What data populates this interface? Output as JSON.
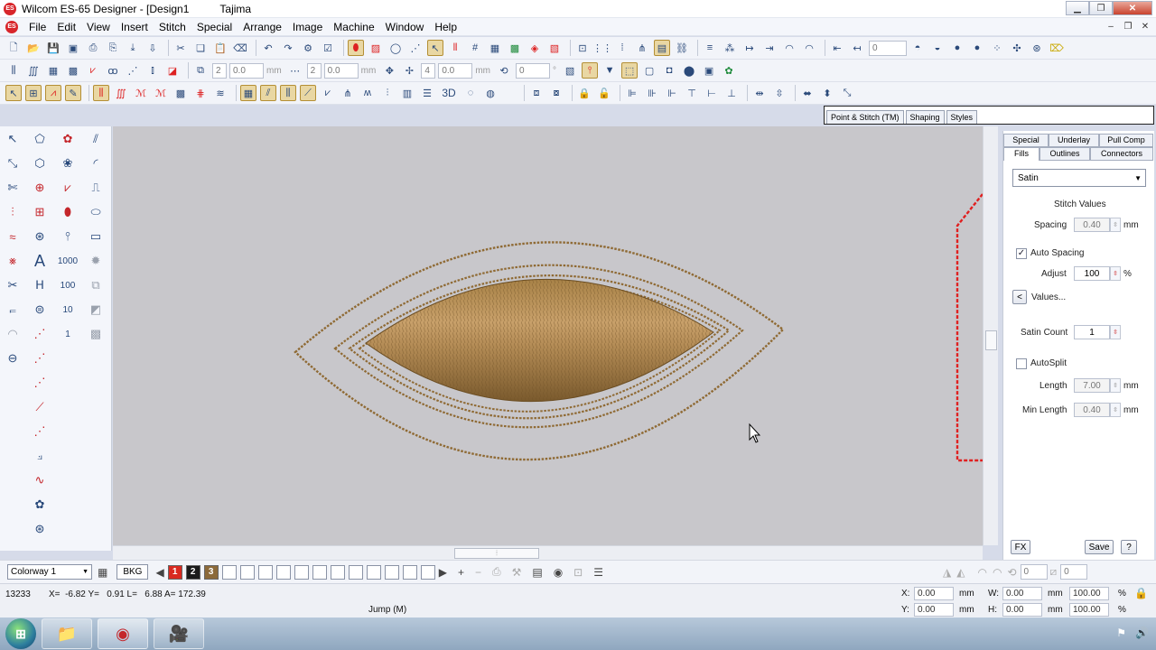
{
  "window": {
    "title": "Wilcom ES-65 Designer - [Design1",
    "machine": "Tajima",
    "app_icon_text": "ES"
  },
  "menu": {
    "items": [
      "File",
      "Edit",
      "View",
      "Insert",
      "Stitch",
      "Special",
      "Arrange",
      "Image",
      "Machine",
      "Window",
      "Help"
    ]
  },
  "toolbar1": {
    "field_zero": "0"
  },
  "toolbar2": {
    "count_a": "2",
    "value_a": "0.0",
    "unit_a": "mm",
    "count_b": "2",
    "value_b": "0.0",
    "unit_b": "mm",
    "count_c": "4",
    "value_c": "0.0",
    "unit_c": "mm",
    "value_d": "0",
    "unit_d": "°"
  },
  "toolbar3": {
    "label_3d": "3D"
  },
  "top_tabs": [
    "Point & Stitch (TM)",
    "Shaping",
    "Styles"
  ],
  "properties": {
    "tabs_row1": [
      "Special",
      "Underlay",
      "Pull Comp"
    ],
    "tabs_row2": [
      "Fills",
      "Outlines",
      "Connectors"
    ],
    "fill_type": "Satin",
    "stitch_values_heading": "Stitch Values",
    "spacing_label": "Spacing",
    "spacing_value": "0.40",
    "spacing_unit": "mm",
    "auto_spacing_label": "Auto Spacing",
    "auto_spacing_checked": true,
    "adjust_label": "Adjust",
    "adjust_value": "100",
    "adjust_unit": "%",
    "values_button": "Values...",
    "values_arrow": "<",
    "satin_count_label": "Satin Count",
    "satin_count_value": "1",
    "autosplit_label": "AutoSplit",
    "autosplit_checked": false,
    "length_label": "Length",
    "length_value": "7.00",
    "length_unit": "mm",
    "min_length_label": "Min Length",
    "min_length_value": "0.40",
    "min_length_unit": "mm",
    "fx_button": "FX",
    "save_button": "Save",
    "help_button": "?"
  },
  "colorbar": {
    "colorway": "Colorway 1",
    "bkg_label": "BKG",
    "swatches": [
      {
        "label": "1",
        "color": "#d92a21"
      },
      {
        "label": "2",
        "color": "#1b1b1b"
      },
      {
        "label": "3",
        "color": "#8c6a3a"
      }
    ],
    "empty_swatch_count": 12,
    "field_zero_a": "0",
    "field_zero_b": "0"
  },
  "status": {
    "stitch_count": "13233",
    "coords": "X=  -6.82 Y=   0.91 L=   6.88 A= 172.39",
    "mode": "Jump (M)",
    "x_label": "X:",
    "x_value": "0.00",
    "y_label": "Y:",
    "y_value": "0.00",
    "w_label": "W:",
    "w_value": "0.00",
    "h_label": "H:",
    "h_value": "0.00",
    "w_pct": "100.00",
    "h_pct": "100.00",
    "unit_mm": "mm",
    "unit_pct": "%"
  },
  "colors": {
    "thread_gold": "#8f6a34",
    "canvas_bg": "#c8c7cb",
    "hoop_red": "#e02020",
    "accent_blue": "#2b4a7a"
  }
}
